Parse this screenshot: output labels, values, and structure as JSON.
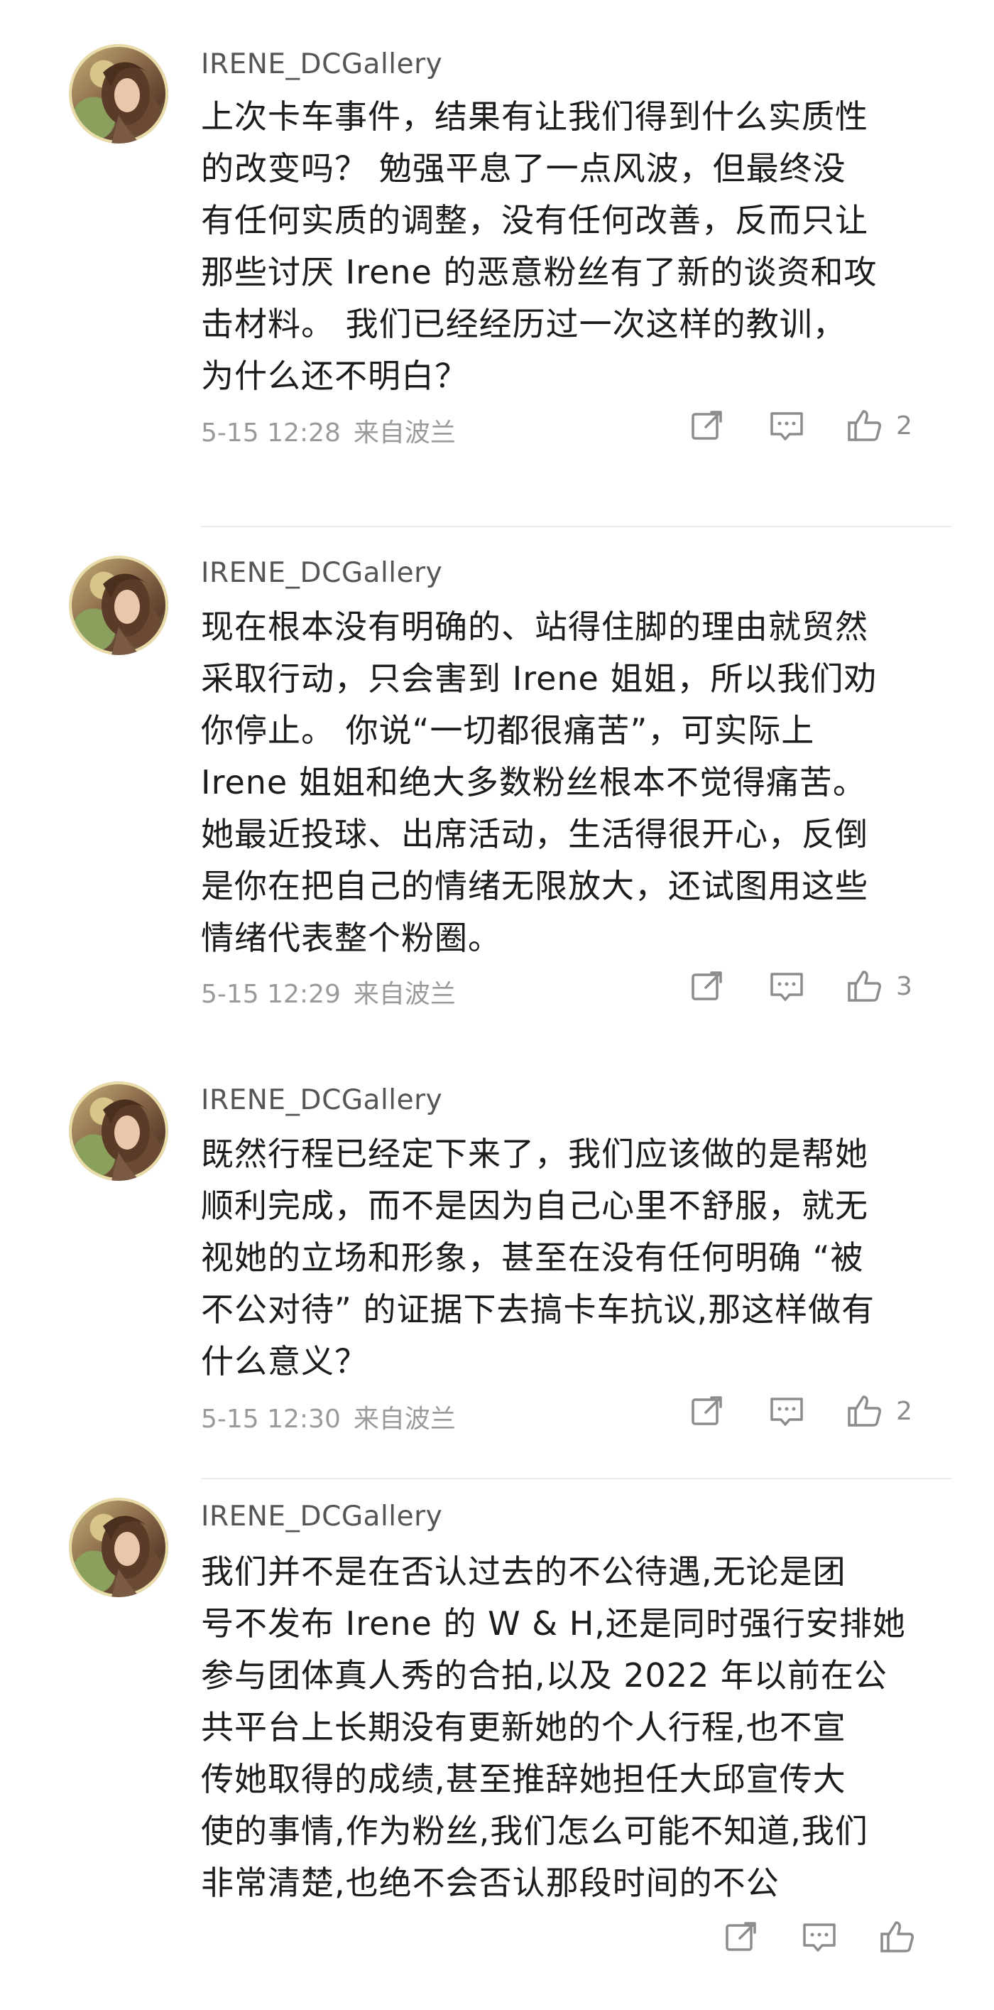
{
  "comments": [
    {
      "username": "IRENE_DCGallery",
      "text": "上次卡车事件，结果有让我们得到什么实质性\n的改变吗？ 勉强平息了一点风波，但最终没\n有任何实质的调整，没有任何改善，反而只让\n那些讨厌 Irene 的恶意粉丝有了新的谈资和攻\n击材料。 我们已经经历过一次这样的教训，\n为什么还不明白？",
      "date": "5-15 12:28",
      "source": "来自波兰",
      "likes": "2"
    },
    {
      "username": "IRENE_DCGallery",
      "text": "现在根本没有明确的、站得住脚的理由就贸然\n采取行动，只会害到 Irene 姐姐，所以我们劝\n你停止。 你说“一切都很痛苦”，可实际上\nIrene 姐姐和绝大多数粉丝根本不觉得痛苦。\n她最近投球、出席活动，生活得很开心，反倒\n是你在把自己的情绪无限放大，还试图用这些\n情绪代表整个粉圈。",
      "date": "5-15 12:29",
      "source": "来自波兰",
      "likes": "3"
    },
    {
      "username": "IRENE_DCGallery",
      "text": "既然行程已经定下来了，我们应该做的是帮她\n顺利完成，而不是因为自己心里不舒服，就无\n视她的立场和形象，甚至在没有任何明确 “被\n不公对待” 的证据下去搞卡车抗议,那这样做有\n什么意义？",
      "date": "5-15 12:30",
      "source": "来自波兰",
      "likes": "2"
    },
    {
      "username": "IRENE_DCGallery",
      "text": "我们并不是在否认过去的不公待遇,无论是团\n号不发布 Irene 的 W & H,还是同时强行安排她\n参与团体真人秀的合拍,以及 2022 年以前在公\n共平台上长期没有更新她的个人行程,也不宣\n传她取得的成绩,甚至推辞她担任大邱宣传大\n使的事情,作为粉丝,我们怎么可能不知道,我们\n非常清楚,也绝不会否认那段时间的不公",
      "date": "",
      "source": "",
      "likes": ""
    }
  ],
  "icons": {
    "share": "share-icon",
    "comment": "comment-icon",
    "like": "thumbs-up-icon"
  },
  "colors": {
    "text": "#1c1c1c",
    "meta": "#9a9a9a",
    "icon": "#8c8c8c"
  }
}
